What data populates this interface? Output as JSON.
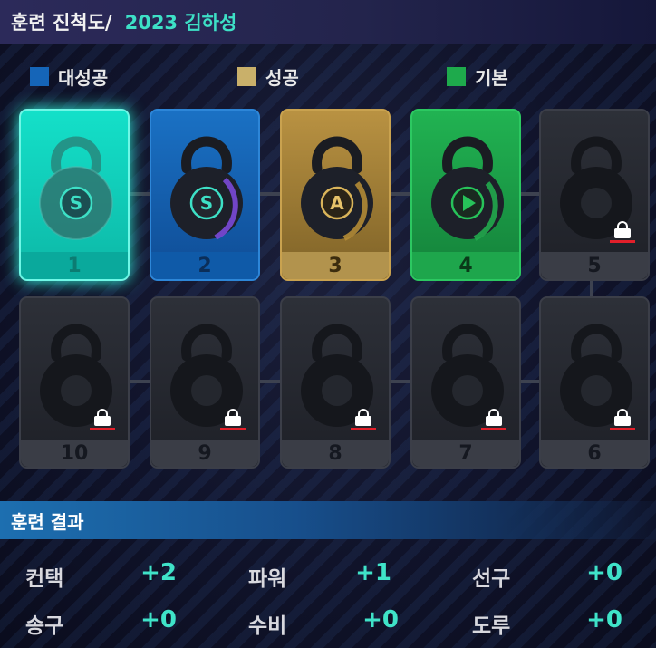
{
  "header": {
    "title": "훈련 진척도/",
    "subtitle": "2023 김하성"
  },
  "legend": [
    {
      "label": "대성공",
      "color": "#1565b8"
    },
    {
      "label": "성공",
      "color": "#c9b06a"
    },
    {
      "label": "기본",
      "color": "#1eaa4c"
    }
  ],
  "cards": [
    {
      "number": "1",
      "grade": "S",
      "state": "current",
      "locked": false
    },
    {
      "number": "2",
      "grade": "S",
      "state": "great-success",
      "locked": false
    },
    {
      "number": "3",
      "grade": "A",
      "state": "success",
      "locked": false
    },
    {
      "number": "4",
      "grade": "play-icon",
      "state": "basic",
      "locked": false
    },
    {
      "number": "5",
      "grade": "",
      "state": "locked",
      "locked": true
    },
    {
      "number": "6",
      "grade": "",
      "state": "locked",
      "locked": true
    },
    {
      "number": "7",
      "grade": "",
      "state": "locked",
      "locked": true
    },
    {
      "number": "8",
      "grade": "",
      "state": "locked",
      "locked": true
    },
    {
      "number": "9",
      "grade": "",
      "state": "locked",
      "locked": true
    },
    {
      "number": "10",
      "grade": "",
      "state": "locked",
      "locked": true
    }
  ],
  "results": {
    "title": "훈련 결과",
    "stats": [
      {
        "name": "컨택",
        "value": "+2"
      },
      {
        "name": "파워",
        "value": "+1"
      },
      {
        "name": "선구",
        "value": "+0"
      },
      {
        "name": "송구",
        "value": "+0"
      },
      {
        "name": "수비",
        "value": "+0"
      },
      {
        "name": "도루",
        "value": "+0"
      }
    ]
  },
  "colors": {
    "accent": "#3de0c6",
    "great_success": "#1565b8",
    "success": "#c9b06a",
    "basic": "#1eaa4c",
    "current": "#14e0c9",
    "lock_red": "#e21f2a"
  }
}
